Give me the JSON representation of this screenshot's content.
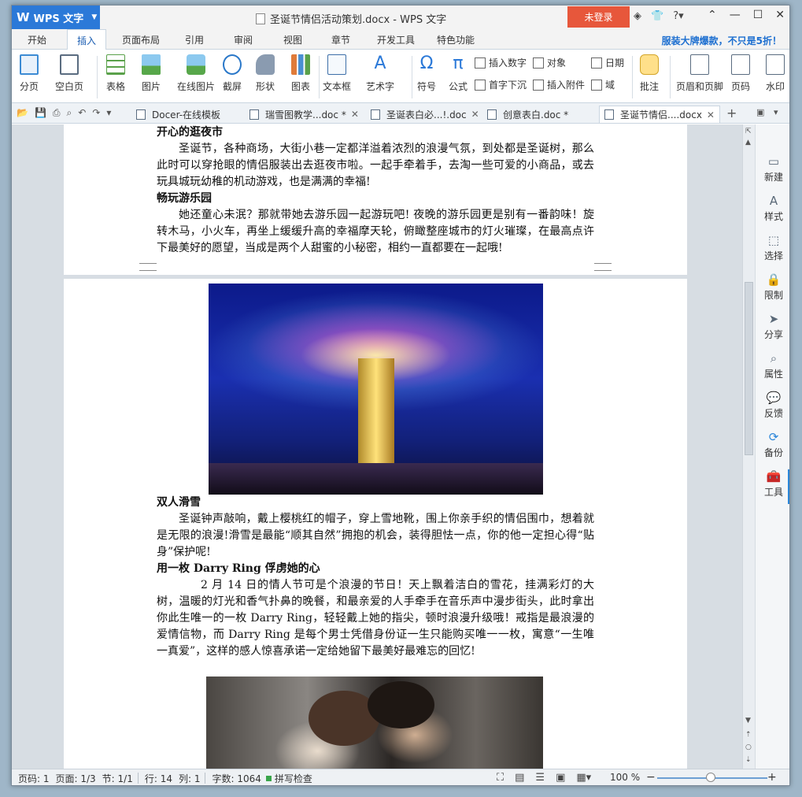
{
  "app": {
    "menu_label": "WPS 文字",
    "doc_title": "圣诞节情侣活动策划.docx - WPS 文字",
    "login": "未登录",
    "promo": "服装大牌爆款，不只是5折！"
  },
  "ribbon_tabs": [
    "开始",
    "插入",
    "页面布局",
    "引用",
    "审阅",
    "视图",
    "章节",
    "开发工具",
    "特色功能"
  ],
  "ribbon": {
    "page_break": "分页",
    "blank_page": "空白页",
    "table": "表格",
    "picture": "图片",
    "online_picture": "在线图片",
    "screenshot": "截屏",
    "shape": "形状",
    "chart": "图表",
    "textbox": "文本框",
    "wordart": "艺术字",
    "symbol": "符号",
    "formula": "公式",
    "insert_number": "插入数字",
    "object": "对象",
    "date": "日期",
    "dropcap": "首字下沉",
    "attachment": "插入附件",
    "field": "域",
    "comment": "批注",
    "header_footer": "页眉和页脚",
    "page_number": "页码",
    "watermark": "水印"
  },
  "doc_tabs": [
    "Docer-在线模板",
    "瑞雪图教学...doc *",
    "圣诞表白必...!.doc",
    "创意表白.doc *",
    "圣诞节情侣....docx"
  ],
  "content": {
    "h1": "开心的逛夜市",
    "p1": "圣诞节，各种商场，大街小巷一定都洋溢着浓烈的浪漫气氛，到处都是圣诞树，那么此时可以穿抢眼的情侣服装出去逛夜市啦。一起手牵着手，去淘一些可爱的小商品，或去玩具城玩幼稚的机动游戏，也是满满的幸福!",
    "h2": "畅玩游乐园",
    "p2": "她还童心未泯？那就带她去游乐园一起游玩吧! 夜晚的游乐园更是别有一番韵味！旋转木马，小火车，再坐上缓缓升高的幸福摩天轮，俯瞰整座城市的灯火璀璨，在最高点许下最美好的愿望，当成是两个人甜蜜的小秘密，相约一直都要在一起哦!",
    "h3": "双人滑雪",
    "p3": "圣诞钟声敲响，戴上樱桃红的帽子，穿上雪地靴，围上你亲手织的情侣围巾，想着就是无限的浪漫!滑雪是最能“顺其自然”拥抱的机会，装得胆怯一点，你的他一定担心得“贴身”保护呢!",
    "h4": "用一枚 Darry Ring 俘虏她的心",
    "p4": "2 月 14 日的情人节可是个浪漫的节日！天上飘着洁白的雪花，挂满彩灯的大树，温暖的灯光和香气扑鼻的晚餐，和最亲爱的人手牵手在音乐声中漫步街头，此时拿出你此生唯一的一枚 Darry Ring，轻轻戴上她的指尖，顿时浪漫升级哦！戒指是最浪漫的爱情信物，而 Darry Ring 是每个男士凭借身份证一生只能购买唯一一枚，寓意“一生唯一真爱”，这样的感人惊喜承诺一定给她留下最美好最难忘的回忆!"
  },
  "sidepanel": [
    "新建",
    "样式",
    "选择",
    "限制",
    "分享",
    "属性",
    "反馈",
    "备份",
    "工具"
  ],
  "status": {
    "page_code": "页码: 1",
    "page": "页面: 1/3",
    "section": "节: 1/1",
    "row": "行: 14",
    "col": "列: 1",
    "words": "字数: 1064",
    "spell": "拼写检查",
    "zoom": "100 %"
  }
}
